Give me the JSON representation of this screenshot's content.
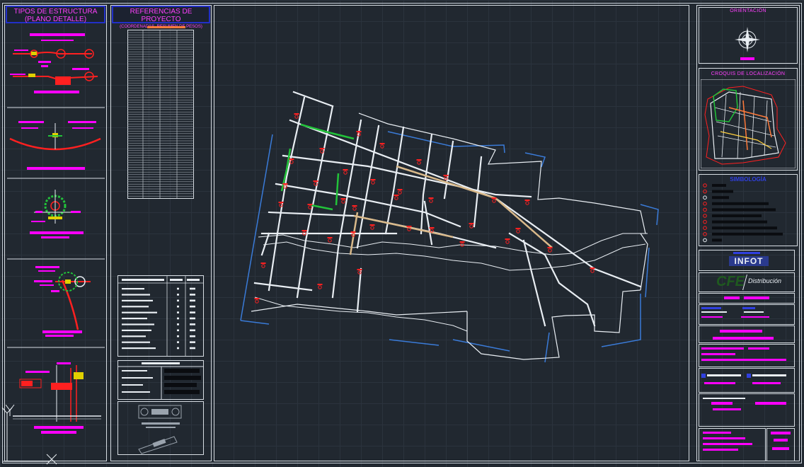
{
  "left_panel": {
    "title_line1": "TIPOS DE ESTRUCTURA",
    "title_line2": "(PLANO DETALLE)"
  },
  "ref_panel": {
    "title": "REFERENCIAS DE PROYECTO",
    "subtitle": "(COORDENADAS, RESUMEN DE PESOS)"
  },
  "right_panel": {
    "orientation_title": "ORIENTACIÓN",
    "croquis_title": "CROQUIS DE LOCALIZACIÓN",
    "simbologia_title": "SIMBOLOGÍA",
    "logo_infot": "INFOT",
    "logo_cfe": "CFE",
    "logo_distribucion": "Distribución"
  },
  "colors": {
    "background": "#212830",
    "border": "#d7dde3",
    "accent_magenta": "#ff00ff",
    "accent_red": "#ff2020",
    "accent_blue": "#2230c8",
    "street_white": "#e9eef3",
    "line_green": "#22c33a"
  }
}
